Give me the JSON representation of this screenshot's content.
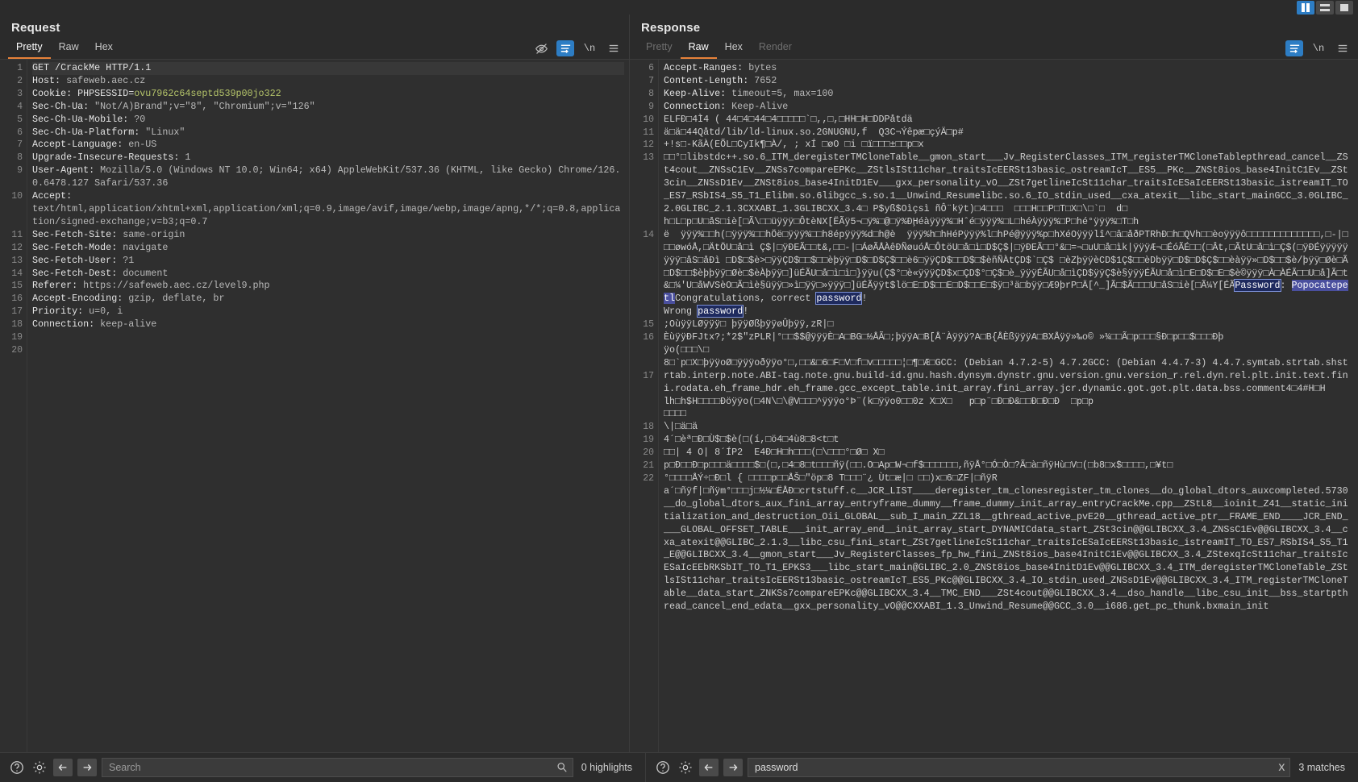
{
  "window": {
    "layout_buttons": [
      {
        "name": "vertical-split",
        "active": true
      },
      {
        "name": "horizontal-split",
        "active": false
      },
      {
        "name": "single-pane",
        "active": false
      }
    ]
  },
  "request": {
    "title": "Request",
    "tabs": [
      {
        "label": "Pretty",
        "active": true,
        "disabled": false
      },
      {
        "label": "Raw",
        "active": false,
        "disabled": false
      },
      {
        "label": "Hex",
        "active": false,
        "disabled": false
      }
    ],
    "icons": [
      {
        "name": "eye-off-icon",
        "active": false
      },
      {
        "name": "word-wrap-icon",
        "active": true
      },
      {
        "name": "newline-icon",
        "label": "\\n",
        "active": false
      },
      {
        "name": "menu-icon",
        "active": false
      }
    ],
    "line_numbers": [
      "1",
      "2",
      "3",
      "4",
      "5",
      "6",
      "7",
      "8",
      "9",
      "",
      "10",
      "",
      "",
      "11",
      "12",
      "13",
      "14",
      "15",
      "16",
      "17",
      "18",
      "19",
      "20"
    ],
    "lines": [
      {
        "n": 1,
        "header": "GET /CrackMe HTTP/1.1",
        "value": "",
        "first": true
      },
      {
        "n": 2,
        "header": "Host:",
        "value": " safeweb.aec.cz"
      },
      {
        "n": 3,
        "header": "Cookie: PHPSESSID=",
        "cookie": "ovu7962c64septd539p00jo322"
      },
      {
        "n": 4,
        "header": "Sec-Ch-Ua:",
        "value": " \"Not/A)Brand\";v=\"8\", \"Chromium\";v=\"126\""
      },
      {
        "n": 5,
        "header": "Sec-Ch-Ua-Mobile:",
        "value": " ?0"
      },
      {
        "n": 6,
        "header": "Sec-Ch-Ua-Platform:",
        "value": " \"Linux\""
      },
      {
        "n": 7,
        "header": "Accept-Language:",
        "value": " en-US"
      },
      {
        "n": 8,
        "header": "Upgrade-Insecure-Requests:",
        "value": " 1"
      },
      {
        "n": 9,
        "header": "User-Agent:",
        "value": " Mozilla/5.0 (Windows NT 10.0; Win64; x64) AppleWebKit/537.36 (KHTML, like Gecko) Chrome/126.0.6478.127 Safari/537.36"
      },
      {
        "n": 10,
        "header": "Accept:",
        "value": "\ntext/html,application/xhtml+xml,application/xml;q=0.9,image/avif,image/webp,image/apng,*/*;q=0.8,application/signed-exchange;v=b3;q=0.7"
      },
      {
        "n": 11,
        "header": "Sec-Fetch-Site:",
        "value": " same-origin"
      },
      {
        "n": 12,
        "header": "Sec-Fetch-Mode:",
        "value": " navigate"
      },
      {
        "n": 13,
        "header": "Sec-Fetch-User:",
        "value": " ?1"
      },
      {
        "n": 14,
        "header": "Sec-Fetch-Dest:",
        "value": " document"
      },
      {
        "n": 15,
        "header": "Referer:",
        "value": " https://safeweb.aec.cz/level9.php"
      },
      {
        "n": 16,
        "header": "Accept-Encoding:",
        "value": " gzip, deflate, br"
      },
      {
        "n": 17,
        "header": "Priority:",
        "value": " u=0, i"
      },
      {
        "n": 18,
        "header": "Connection:",
        "value": " keep-alive"
      },
      {
        "n": 19,
        "header": "",
        "value": ""
      },
      {
        "n": 20,
        "header": "",
        "value": ""
      }
    ],
    "search": {
      "placeholder": "Search",
      "value": "",
      "matches": "0 highlights"
    }
  },
  "response": {
    "title": "Response",
    "tabs": [
      {
        "label": "Pretty",
        "active": false,
        "disabled": true
      },
      {
        "label": "Raw",
        "active": true,
        "disabled": false
      },
      {
        "label": "Hex",
        "active": false,
        "disabled": false
      },
      {
        "label": "Render",
        "active": false,
        "disabled": true
      }
    ],
    "icons": [
      {
        "name": "word-wrap-icon",
        "active": true
      },
      {
        "name": "newline-icon",
        "label": "\\n",
        "active": false
      },
      {
        "name": "menu-icon",
        "active": false
      }
    ],
    "gutter": [
      "6",
      "7",
      "8",
      "9",
      "10",
      "11",
      "12",
      "13",
      "",
      "",
      "",
      "",
      "",
      "14",
      "",
      "",
      "",
      "",
      "",
      "",
      "",
      "",
      "",
      "",
      "15",
      "16",
      "",
      "",
      "17",
      "",
      "",
      "",
      "",
      "",
      "18",
      "19",
      "20",
      "21",
      "22"
    ],
    "lines": [
      {
        "n": 6,
        "header": "Accept-Ranges:",
        "value": " bytes"
      },
      {
        "n": 7,
        "header": "Content-Length:",
        "value": " 7652"
      },
      {
        "n": 8,
        "header": "Keep-Alive:",
        "value": " timeout=5, max=100"
      },
      {
        "n": 9,
        "header": "Connection:",
        "value": " Keep-Alive"
      },
      {
        "n": 10,
        "header": "",
        "value": ""
      },
      {
        "n": 11,
        "binary": "ELFÐ□4Ì4 ( 44□4□44□4□□□□□`□,,□,□HH□H□DDPåtdä"
      },
      {
        "n": 12,
        "binary": "ä□ä□44Qåtd/lib/ld-linux.so.2GNUGNU,f  Q3C¬Ýêpæ□çýÄ□p#"
      },
      {
        "n": 13,
        "binary": "+!s□-KãÀ(EÕL□CyIk¶□À/, ; xÍ □øO □i □ï□□□±□□p□x\n□□°□libstdc++.so.6_ITM_deregisterTMCloneTable__gmon_start___Jv_RegisterClasses_ITM_registerTMCloneTablepthread_cancel__ZSt4cout__ZNSsC1Ev__ZNSs7compareEPKc__ZStlsISt11char_traitsIcEERSt13basic_ostreamIcT__ES5__PKc__ZNSt8ios_base4InitC1Ev__ZSt3cin__ZNSsD1Ev__ZNSt8ios_base4InitD1Ev___gxx_personality_vO__ZSt7getlineIcSt11char_traitsIcESaIcEERSt13basic_istreamIT_TO_ES7_RSbIS4_S5_T1_Elibm.so.6libgcc_s.so.1__Unwind_Resumelibc.so.6_IO_stdin_used__cxa_atexit__libc_start_mainGCC_3.0GLIBC_2.0GLIBC_2.1.3CXXABI_1.3GLIBCXX_3.4□ P$yß$Oìçsì ñÔ¨kÿt)□4□□□  □□□H□□P□T□X□\\□`□  d□"
      },
      {
        "n": 14,
        "binary": "h□L□p□U□åS□iè[□Ã\\□□üÿÿÿ□ÔtèNX[ËÃÿ5¬□ÿ%□@□ÿ%ÐḨéàÿÿÿ%□Hˆé□ÿÿÿ%□L□héÀÿÿÿ%□P□hé°ÿÿÿ%□T□h\në  ÿÿÿ%□□h(□ÿÿÿ%□□hÖë□ÿÿÿ%□□h8épÿÿÿ%d□h@è  ÿÿÿ%h□hHéPÿÿÿ%l□hPé@ÿÿÿ%p□hXéOÿÿÿlî^□â□åðPTRhÐ□h□QVh□□èoÿÿÿô□□□□□□□□□□□□□,□-|□□□øwóÅ,□ÄtÖU□å□ì Ç$|□ÿÐEÃ□□t&,□□-|□ÁøÃÅÀêÐÑøuóÅ□ÔtöU□å□ì□D$Ç$|□ÿÐEÃ□□°&□=¬□uU□å□ìk|ÿÿÿÆ¬□ÉóÃÉ□□(□Ât,□ÃtU□å□ì□Ç$(□ÿÐÉÿÿÿÿÿÿÿÿ□åS□åÐì □D$□$è>□ÿÿÇD$□□$□□èþÿÿ□D$□D$Ç$□□è6□ÿÿÇD$□□D$□$èñÑÀtÇD$`□Ç$ □èZþÿÿèCD$1Ç$□□èDbÿÿ□D$□D$Ç$□□èàÿÿ»□D$□□$è/þÿÿ□Øè□Ã□D$□□$èþþÿÿ□Øè□$èÀþÿÿ□]üÉÃU□å□ì□ì□}ÿÿu(Ç$°□è«ÿÿÿÇD$x□ÇD$°□Ç$□è_ÿÿÿÉÃU□å□ìÇD$ÿÿÇ$è§ÿÿÿÉÃU□å□ì□E□D$□E□$è©ÿÿÿ□À□ÀÉÃ□□U□å]Ã□t&□¼'U□åWVSèO□Ã□ìè§üÿÿ□»ì□ÿÿ□»ÿÿÿ□]üÉÃÿÿt$lö□E□D$□□E□D$□□E□$ÿ□³ä□bÿÿ□Æ9þrP□Ä[^_]Ã□$Ã□□□U□åS□iè[□Ã¼Y[ÉÃ",
        "hl_password": "Password",
        "after_hl": ": ",
        "hl_match": "Popocatepetl",
        "tail": "Congratulations, correct ",
        "hl_match2": "password",
        "tail2": "!"
      },
      {
        "n": 15,
        "wrongtext": "Wrong ",
        "hl_match": "password",
        "tail": "!"
      },
      {
        "n": 16,
        "binary": ";OùÿÿLØÿÿÿ□ þÿÿØßþÿÿøÛþÿÿ,zR|□\nÈùÿÿÐFJtx?;*2$\"zPLR|°□□$$@ÿÿÿÈ□A□BG□½ÅÃ□;þÿÿA□B[Å¨Àÿÿÿ?A□B{ÅÈßÿÿÿA□BXÅÿÿ»‰o© »¾□□Ã□p□□□§Ð□p□□$□□□Ðþ\nÿo(□□□\\□"
      },
      {
        "n": 17,
        "binary": "8□`p□X□þÿÿoØ□ÿÿÿoðÿÿo°□,□□&□6□F□V□f□v□□□□□¦□¶□Æ□GCC: (Debian 4.7.2-5) 4.7.2GCC: (Debian 4.4.7-3) 4.4.7.symtab.strtab.shstrtab.interp.note.ABI-tag.note.gnu.build-id.gnu.hash.dynsym.dynstr.gnu.version.gnu.version_r.rel.dyn.rel.plt.init.text.fini.rodata.eh_frame_hdr.eh_frame.gcc_except_table.init_array.fini_array.jcr.dynamic.got.got.plt.data.bss.comment4□4#H□H\nlh□h$H□□□□Ðöÿÿo(□4N\\□\\@V□□□^ÿÿÿo°Þ¨(k□ÿÿo0□□0z X□X□   p□p¨□Ð□Ð&□□Ð□Ð□Ð  □p□p"
      },
      {
        "n": 18,
        "binary": "□□□□"
      },
      {
        "n": 19,
        "binary": "\\|□ä□ä"
      },
      {
        "n": 20,
        "binary": "4´□èª□Ð□Ù$□$è(□(í,□ö4□4ù8□8<t□t"
      },
      {
        "n": 21,
        "binary": "□□| 4 O| 8´ÍP2  E4Ð□H□h□□□(□\\□□□°□Ø□ X□"
      },
      {
        "n": 22,
        "binary": "p□Ð□□Ð□p□□□ä□□□□$□(□,□4□8□t□□□ñÿ(□□.O□Ap□W¬□f$□□□□□□,ñÿÅ°□Ó□Ò□?Ã□à□ñÿHù□V□(□b8□x$□□□□,□¥t□\n°□□□□ÅÝ÷□Ð□l { □□□□p□□ÅŠ□\"öp□8 T□□□¨¿ Ùt□æ|□ □□)x□6□ZF|□ñÿR\na´□ñÿf|□ñÿm°□□□j□½¼□ËÅÐ□crtstuff.c__JCR_LIST____deregister_tm_clonesregister_tm_clones__do_global_dtors_auxcompleted.5730__do_global_dtors_aux_fini_array_entryframe_dummy__frame_dummy_init_array_entryCrackMe.cpp__ZStL8__ioinit_Z41__static_initialization_and_destruction_Oii_GLOBAL__sub_I_main_ZZL18__gthread_active_pvE20__gthread_active_ptr__FRAME_END____JCR_END____GLOBAL_OFFSET_TABLE___init_array_end__init_array_start_DYNAMICdata_start_ZSt3cin@@GLIBCXX_3.4_ZNSsC1Ev@@GLIBCXX_3.4__cxa_atexit@@GLIBC_2.1.3__libc_csu_fini_start_ZSt7getlineIcSt11char_traitsIcESaIcEERSt13basic_istreamIT_TO_ES7_RSbIS4_S5_T1_E@@GLIBCXX_3.4__gmon_start___Jv_RegisterClasses_fp_hw_fini_ZNSt8ios_base4InitC1Ev@@GLIBCXX_3.4_ZStexqIcSt11char_traitsIcESaIcEEbRKSbIT_TO_T1_EPKS3___libc_start_main@GLIBC_2.0_ZNSt8ios_base4InitD1Ev@@GLIBCXX_3.4_ITM_deregisterTMCloneTable_ZStlsISt11char_traitsIcEERSt13basic_ostreamIcT_ES5_PKc@@GLIBCXX_3.4_IO_stdin_used_ZNSsD1Ev@@GLIBCXX_3.4_ITM_registerTMCloneTable__data_start_ZNKSs7compareEPKc@@GLIBCXX_3.4__TMC_END___ZSt4cout@@GLIBCXX_3.4__dso_handle__libc_csu_init__bss_startpthread_cancel_end_edata__gxx_personality_vO@@CXXABI_1.3_Unwind_Resume@@GCC_3.0__i686.get_pc_thunk.bxmain_init"
      }
    ],
    "search": {
      "placeholder": "Search",
      "value": "password",
      "clear_label": "x",
      "matches": "3 matches"
    }
  },
  "colors": {
    "accent_orange": "#e8833a",
    "accent_blue": "#2d7dc4",
    "cookie_green": "#b5c46a",
    "highlight_dark": "#1e2a5e",
    "highlight_select": "#4a4f9e"
  }
}
